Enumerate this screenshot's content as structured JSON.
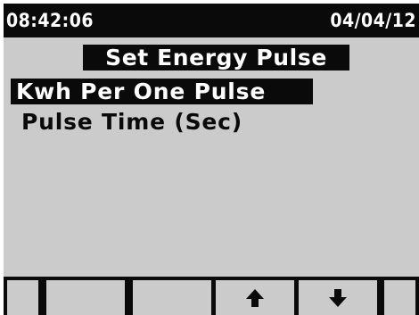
{
  "status_bar": {
    "time": "08:42:06",
    "date": "04/04/12"
  },
  "menu": {
    "title": "Set Energy Pulse",
    "items": [
      {
        "label": "Kwh Per One Pulse",
        "selected": true
      },
      {
        "label": "Pulse Time (Sec)",
        "selected": false
      }
    ]
  },
  "softkeys": [
    {
      "icon": "",
      "label": ""
    },
    {
      "icon": "",
      "label": ""
    },
    {
      "icon": "",
      "label": ""
    },
    {
      "icon": "arrow-up-icon",
      "label": ""
    },
    {
      "icon": "arrow-down-icon",
      "label": ""
    },
    {
      "icon": "",
      "label": ""
    }
  ],
  "colors": {
    "screen_background": "#cbcbcb",
    "ink": "#0a0a0a",
    "inverse_text": "#ffffff"
  }
}
